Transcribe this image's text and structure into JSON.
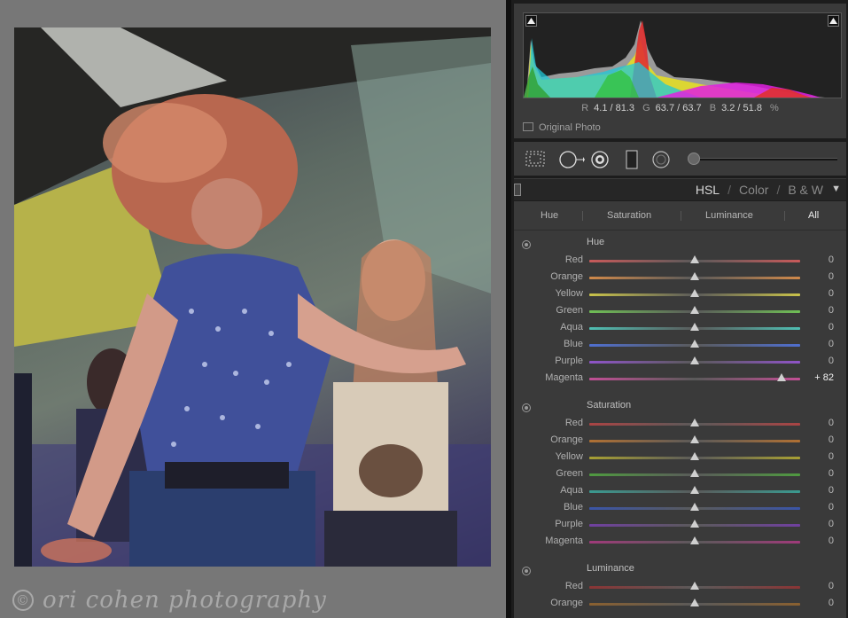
{
  "watermark": {
    "symbol": "©",
    "text": "ori cohen photography"
  },
  "histogram": {
    "readout": {
      "r_label": "R",
      "r_value": "4.1 / 81.3",
      "g_label": "G",
      "g_value": "63.7 / 63.7",
      "b_label": "B",
      "b_value": "3.2 / 51.8",
      "unit": "%"
    },
    "original_photo_label": "Original Photo"
  },
  "tools": [
    "crop-overlay-icon",
    "spot-removal-icon",
    "red-eye-icon",
    "graduated-filter-icon",
    "radial-filter-icon",
    "adjustment-brush-icon"
  ],
  "hsl": {
    "panel_titles": {
      "hsl": "HSL",
      "sep1": "/",
      "color": "Color",
      "sep2": "/",
      "bw": "B & W"
    },
    "collapse_glyph": "▼",
    "tabs": {
      "hue": "Hue",
      "saturation": "Saturation",
      "luminance": "Luminance",
      "all": "All"
    },
    "active_tab": "All",
    "sections": {
      "hue": {
        "title": "Hue",
        "rows": [
          {
            "label": "Red",
            "value": "0",
            "level": 0
          },
          {
            "label": "Orange",
            "value": "0",
            "level": 0
          },
          {
            "label": "Yellow",
            "value": "0",
            "level": 0
          },
          {
            "label": "Green",
            "value": "0",
            "level": 0
          },
          {
            "label": "Aqua",
            "value": "0",
            "level": 0
          },
          {
            "label": "Blue",
            "value": "0",
            "level": 0
          },
          {
            "label": "Purple",
            "value": "0",
            "level": 0
          },
          {
            "label": "Magenta",
            "value": "+ 82",
            "level": 82
          }
        ]
      },
      "saturation": {
        "title": "Saturation",
        "rows": [
          {
            "label": "Red",
            "value": "0",
            "level": 0
          },
          {
            "label": "Orange",
            "value": "0",
            "level": 0
          },
          {
            "label": "Yellow",
            "value": "0",
            "level": 0
          },
          {
            "label": "Green",
            "value": "0",
            "level": 0
          },
          {
            "label": "Aqua",
            "value": "0",
            "level": 0
          },
          {
            "label": "Blue",
            "value": "0",
            "level": 0
          },
          {
            "label": "Purple",
            "value": "0",
            "level": 0
          },
          {
            "label": "Magenta",
            "value": "0",
            "level": 0
          }
        ]
      },
      "luminance": {
        "title": "Luminance",
        "rows": [
          {
            "label": "Red",
            "value": "0",
            "level": 0
          },
          {
            "label": "Orange",
            "value": "0",
            "level": 0
          }
        ]
      }
    }
  },
  "colors": {
    "panel_bg": "#3a3a3a",
    "hue_tracks": [
      "#c85a5a",
      "#d0894a",
      "#c9c24a",
      "#6fbf55",
      "#4fbfb3",
      "#4f6fd0",
      "#8f54c8",
      "#c24f95"
    ],
    "sat_tracks": [
      "#a44",
      "#b07033",
      "#a8a033",
      "#4f9a40",
      "#3a9a90",
      "#3a55a8",
      "#7040a0",
      "#a03a7a"
    ],
    "lum_tracks": [
      "#8a3535",
      "#8a6030"
    ]
  }
}
